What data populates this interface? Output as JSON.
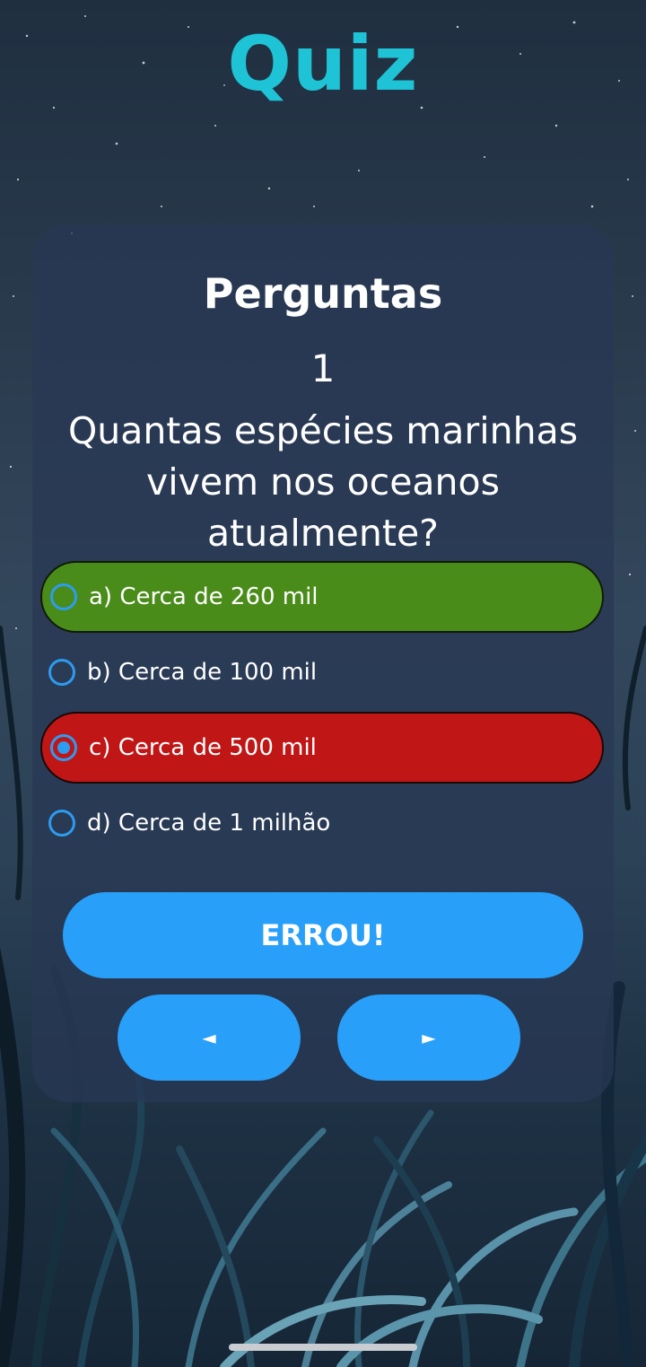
{
  "app": {
    "title": "Quiz"
  },
  "quiz": {
    "section_title": "Perguntas",
    "question_number": "1",
    "question_text": "Quantas espécies marinhas vivem nos oceanos atualmente?",
    "options": [
      {
        "label": "a) Cerca de 260 mil",
        "state": "correct",
        "selected": false
      },
      {
        "label": "b) Cerca de 100 mil",
        "state": "none",
        "selected": false
      },
      {
        "label": "c) Cerca de 500 mil",
        "state": "wrong",
        "selected": true
      },
      {
        "label": "d) Cerca de 1 milhão",
        "state": "none",
        "selected": false
      }
    ],
    "result_button": "ERROU!",
    "prev_button": "◄",
    "next_button": "►"
  },
  "colors": {
    "title": "#1ec3d6",
    "correct": "#4a8c1a",
    "wrong": "#c01616",
    "button": "#289ff9",
    "radio": "#2d9bf0"
  }
}
